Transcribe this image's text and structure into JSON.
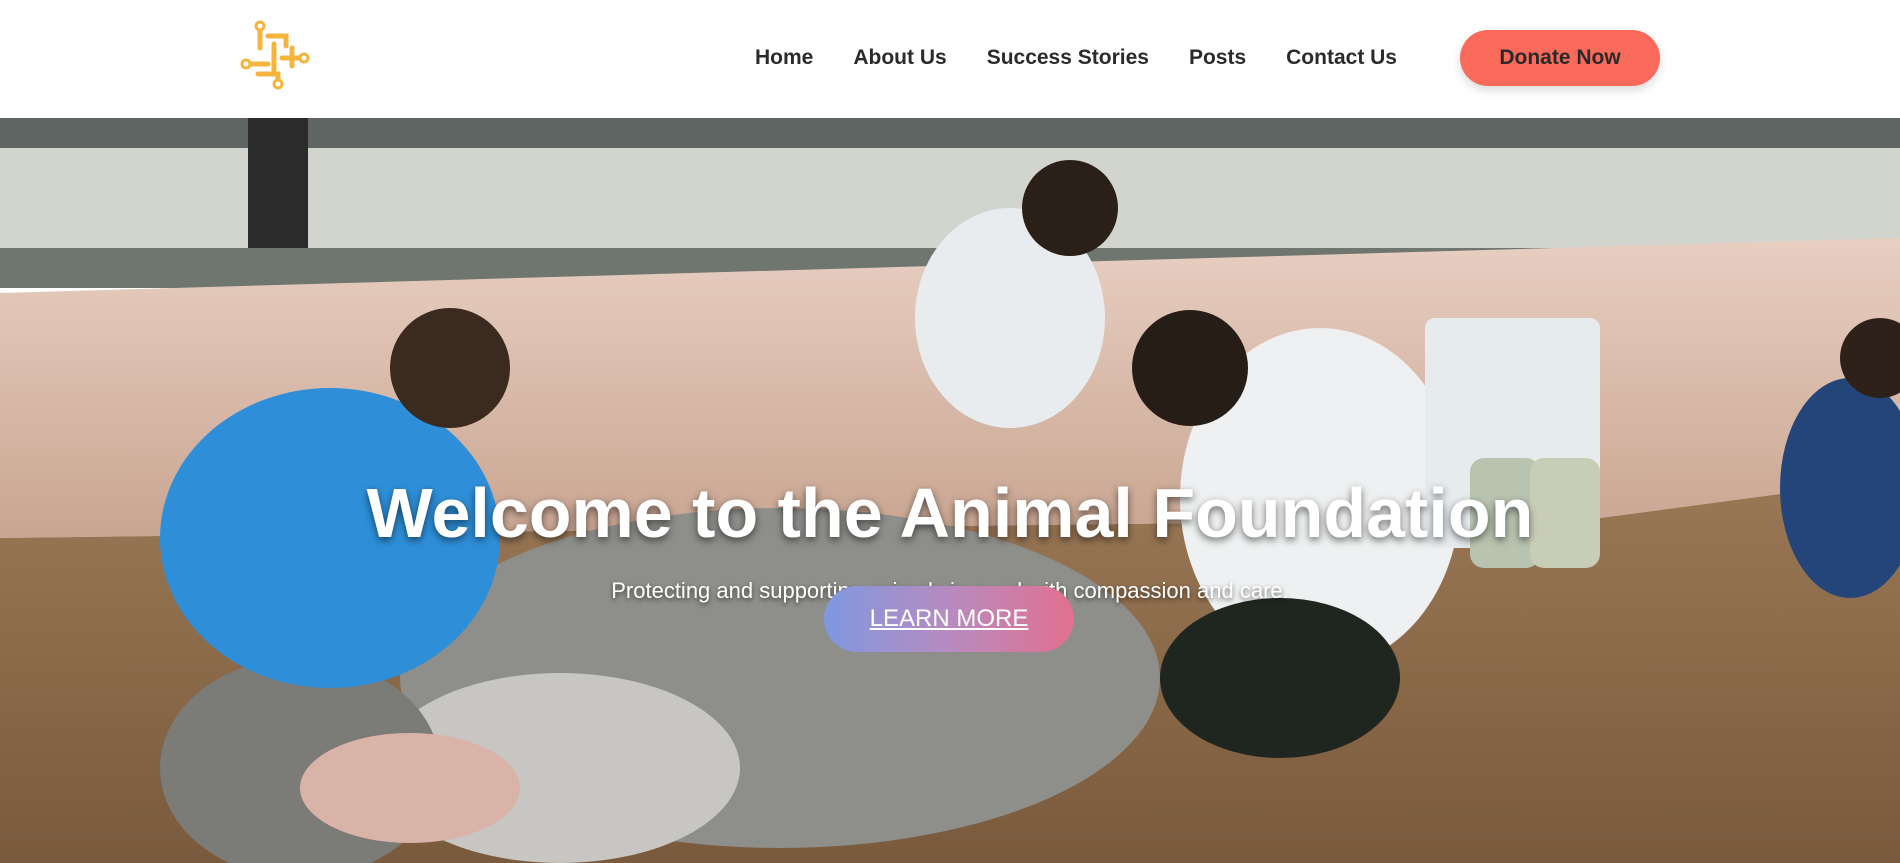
{
  "nav": {
    "logo_icon": "circuit-logo-icon",
    "items": [
      {
        "label": "Home"
      },
      {
        "label": "About Us"
      },
      {
        "label": "Success Stories"
      },
      {
        "label": "Posts"
      },
      {
        "label": "Contact Us"
      }
    ],
    "donate_label": "Donate Now"
  },
  "hero": {
    "title": "Welcome to the Animal Foundation",
    "subtitle": "Protecting and supporting animals in need with compassion and care.",
    "cta_label": "LEARN MORE",
    "image_icon": "veterinary-team-cow-photo"
  },
  "colors": {
    "brand_logo": "#f5b43c",
    "donate": "#fa6a5b",
    "cta_gradient_start": "#7f98e0",
    "cta_gradient_end": "#e2708f"
  }
}
